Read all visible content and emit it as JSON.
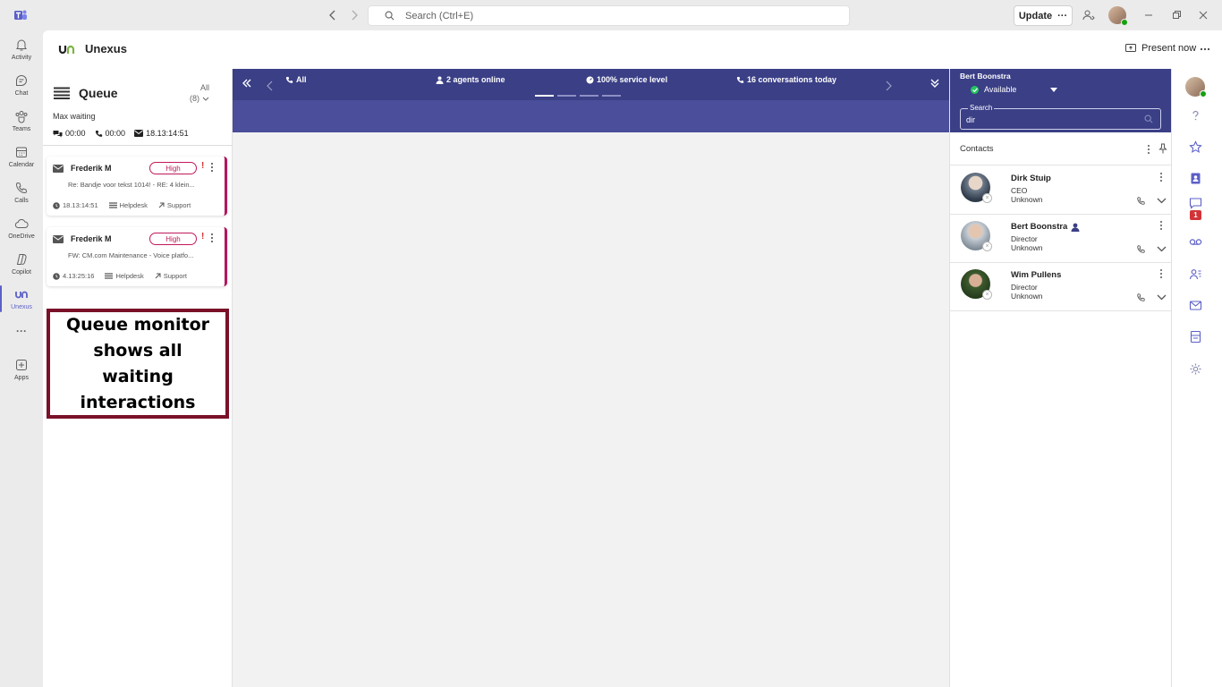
{
  "titlebar": {
    "search_placeholder": "Search (Ctrl+E)",
    "update_label": "Update",
    "update_more": "···"
  },
  "rail": [
    {
      "label": "Activity",
      "icon": "bell-icon"
    },
    {
      "label": "Chat",
      "icon": "chat-icon"
    },
    {
      "label": "Teams",
      "icon": "teams-icon"
    },
    {
      "label": "Calendar",
      "icon": "calendar-icon"
    },
    {
      "label": "Calls",
      "icon": "phone-icon"
    },
    {
      "label": "OneDrive",
      "icon": "cloud-icon"
    },
    {
      "label": "Copilot",
      "icon": "copilot-icon"
    },
    {
      "label": "Unexus",
      "icon": "unexus-icon",
      "active": true
    },
    {
      "label": "···",
      "icon": "more-icon"
    },
    {
      "label": "Apps",
      "icon": "add-app-icon"
    }
  ],
  "app": {
    "title": "Unexus",
    "present_label": "Present now"
  },
  "queue": {
    "title": "Queue",
    "filter_label": "All",
    "filter_count": "(8)",
    "max_waiting_label": "Max waiting",
    "stats": {
      "chat": "00:00",
      "call": "00:00",
      "email": "18.13:14:51"
    },
    "items": [
      {
        "name": "Frederik M",
        "priority": "High",
        "alert": "!",
        "subject": "Re: Bandje voor tekst 1014! - RE: 4 klein...",
        "wait": "18.13:14:51",
        "queue": "Helpdesk",
        "skill": "Support"
      },
      {
        "name": "Frederik M",
        "priority": "High",
        "alert": "!",
        "subject": "FW: CM.com Maintenance - Voice platfo...",
        "wait": "4.13:25:16",
        "queue": "Helpdesk",
        "skill": "Support"
      }
    ]
  },
  "callout": {
    "text": "Queue monitor shows all waiting interactions"
  },
  "banner": {
    "items": [
      {
        "text": "All",
        "icon": "phone-icon"
      },
      {
        "text": "2 agents online",
        "icon": "person-icon"
      },
      {
        "text": "100% service level",
        "icon": "gauge-icon"
      },
      {
        "text": "16 conversations today",
        "icon": "phone-icon"
      }
    ],
    "pages": 4,
    "active_page": 1
  },
  "contacts": {
    "user_name": "Bert Boonstra",
    "status": "Available",
    "search_label": "Search",
    "search_value": "dir",
    "section_title": "Contacts",
    "list": [
      {
        "name": "Dirk Stuip",
        "role": "CEO",
        "status": "Unknown",
        "is_self": false
      },
      {
        "name": "Bert Boonstra",
        "role": "Director",
        "status": "Unknown",
        "is_self": true
      },
      {
        "name": "Wim Pullens",
        "role": "Director",
        "status": "Unknown",
        "is_self": false
      }
    ]
  },
  "right_rail": {
    "chat_badge": "1",
    "icons": [
      "help-icon",
      "star-icon",
      "contact-card-icon",
      "chat-icon",
      "voicemail-icon",
      "contacts-icon",
      "mail-icon",
      "notes-icon",
      "settings-icon"
    ]
  },
  "colors": {
    "brand": "#5b5fc7",
    "banner": "#3a3f86",
    "priority": "#c2185b",
    "callout_border": "#7a1128"
  }
}
